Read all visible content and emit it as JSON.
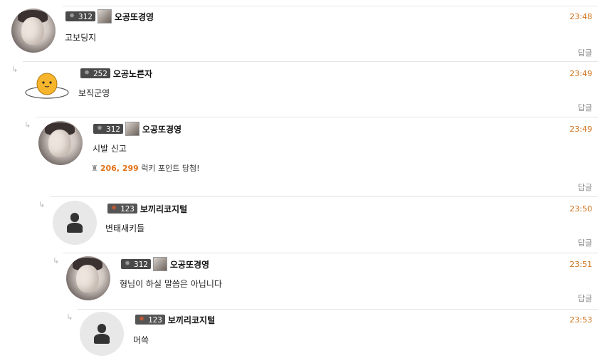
{
  "reply_label": "답글",
  "arrow_glyph": "↳",
  "comments": [
    {
      "level": "312",
      "nickname": "오공또경영",
      "time": "23:48",
      "text": "고보딩지"
    },
    {
      "level": "252",
      "nickname": "오공노른자",
      "time": "23:49",
      "text": "보직군영"
    },
    {
      "level": "312",
      "nickname": "오공또경영",
      "time": "23:49",
      "text": "시발 신고",
      "lucky": {
        "points": "206, 299",
        "suffix": "럭키 포인트 당첨!"
      }
    },
    {
      "level": "123",
      "nickname": "보끼리코지털",
      "time": "23:50",
      "text": "변태새키들"
    },
    {
      "level": "312",
      "nickname": "오공또경영",
      "time": "23:51",
      "text": "형님이 하실 말씀은 아닙니다"
    },
    {
      "level": "123",
      "nickname": "보끼리코지털",
      "time": "23:53",
      "text": "머쓱"
    }
  ],
  "colors": {
    "time": "#d0741e",
    "points": "#e2741a",
    "separator": "#e4e4e4"
  },
  "icons": [
    "gear-badge-icon",
    "user-silhouette-icon",
    "reply-arrow-icon",
    "coin-icon"
  ]
}
